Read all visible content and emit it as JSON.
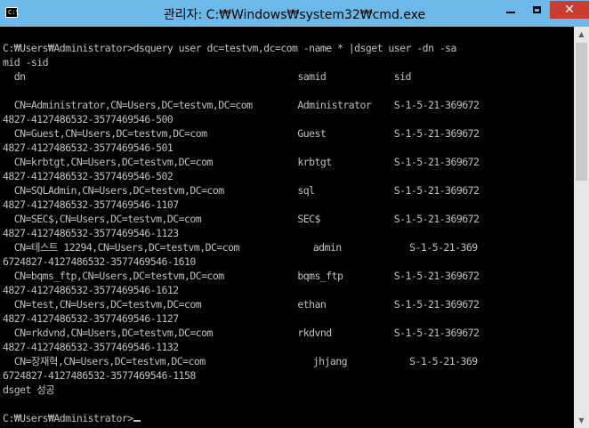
{
  "window": {
    "title": "관리자: C:₩Windows₩system32₩cmd.exe",
    "icon_label": "C:\\",
    "controls": {
      "minimize_icon": "minimize-icon",
      "maximize_icon": "maximize-icon",
      "close_label": "✕"
    }
  },
  "console": {
    "lines": [
      "C:₩Users₩Administrator>dsquery user dc=testvm,dc=com -name * |dsget user -dn -sa",
      "mid -sid",
      "  dn                                                samid            sid",
      "",
      "  CN=Administrator,CN=Users,DC=testvm,DC=com        Administrator    S-1-5-21-369672",
      "4827-4127486532-3577469546-500",
      "  CN=Guest,CN=Users,DC=testvm,DC=com                Guest            S-1-5-21-369672",
      "4827-4127486532-3577469546-501",
      "  CN=krbtgt,CN=Users,DC=testvm,DC=com               krbtgt           S-1-5-21-369672",
      "4827-4127486532-3577469546-502",
      "  CN=SQLAdmin,CN=Users,DC=testvm,DC=com             sql              S-1-5-21-369672",
      "4827-4127486532-3577469546-1107",
      "  CN=SEC$,CN=Users,DC=testvm,DC=com                 SEC$             S-1-5-21-369672",
      "4827-4127486532-3577469546-1123",
      "  CN=테스트 12294,CN=Users,DC=testvm,DC=com             admin            S-1-5-21-369",
      "6724827-4127486532-3577469546-1610",
      "  CN=bqms_ftp,CN=Users,DC=testvm,DC=com             bqms_ftp         S-1-5-21-369672",
      "4827-4127486532-3577469546-1612",
      "  CN=test,CN=Users,DC=testvm,DC=com                 ethan            S-1-5-21-369672",
      "4827-4127486532-3577469546-1127",
      "  CN=rkdvnd,CN=Users,DC=testvm,DC=com               rkdvnd           S-1-5-21-369672",
      "4827-4127486532-3577469546-1132",
      "  CN=장재혁,CN=Users,DC=testvm,DC=com                   jhjang           S-1-5-21-369",
      "6724827-4127486532-3577469546-1158",
      "dsget 성공",
      "",
      "C:₩Users₩Administrator>"
    ]
  },
  "colors": {
    "titlebar": "#6cb8e8",
    "console_bg": "#000000",
    "console_fg": "#c0c0c0",
    "close_bg": "#c83c31"
  }
}
